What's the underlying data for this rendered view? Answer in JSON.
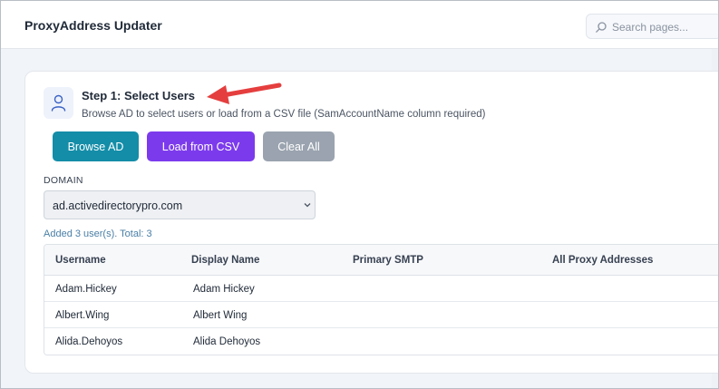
{
  "app": {
    "title": "ProxyAddress Updater"
  },
  "search": {
    "placeholder": "Search pages..."
  },
  "step": {
    "title": "Step 1: Select Users",
    "description": "Browse AD to select users or load from a CSV file (SamAccountName column required)",
    "icon": "user-icon"
  },
  "buttons": {
    "browse_ad": "Browse AD",
    "load_csv": "Load from CSV",
    "clear_all": "Clear All"
  },
  "domain": {
    "label": "DOMAIN",
    "selected": "ad.activedirectorypro.com"
  },
  "status": "Added 3 user(s). Total: 3",
  "table": {
    "columns": [
      "Username",
      "Display Name",
      "Primary SMTP",
      "All Proxy Addresses"
    ],
    "rows": [
      {
        "username": "Adam.Hickey",
        "display_name": "Adam Hickey",
        "primary_smtp": "",
        "all_proxy": ""
      },
      {
        "username": "Albert.Wing",
        "display_name": "Albert Wing",
        "primary_smtp": "",
        "all_proxy": ""
      },
      {
        "username": "Alida.Dehoyos",
        "display_name": "Alida Dehoyos",
        "primary_smtp": "",
        "all_proxy": ""
      }
    ]
  },
  "colors": {
    "browse_button": "#148da8",
    "load_button": "#7c3aed",
    "clear_button": "#9aa3af",
    "annotation_arrow": "#e53e3e",
    "status_text": "#4a7fa6"
  }
}
